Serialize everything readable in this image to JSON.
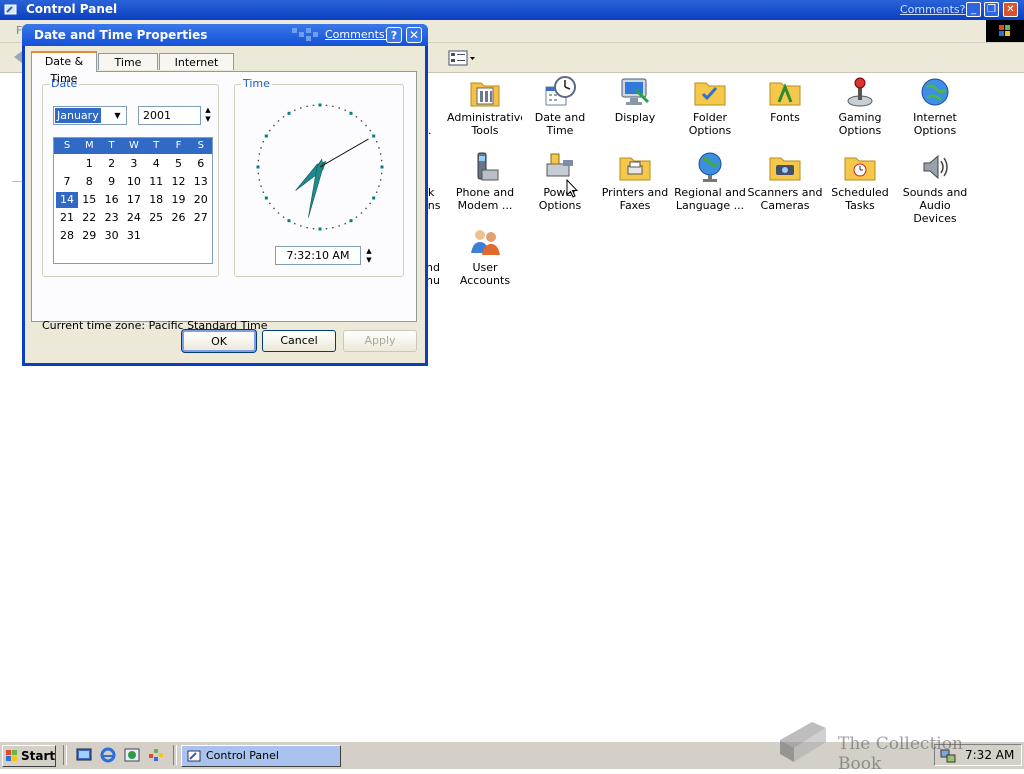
{
  "control_panel": {
    "title": "Control Panel",
    "comments_link": "Comments?",
    "menu_partial": "F",
    "items": [
      {
        "label": "Administrative Tools",
        "icon": "administrative-tools-icon"
      },
      {
        "label": "Date and Time",
        "icon": "date-and-time-icon"
      },
      {
        "label": "Display",
        "icon": "display-icon"
      },
      {
        "label": "Folder Options",
        "icon": "folder-options-icon"
      },
      {
        "label": "Fonts",
        "icon": "fonts-icon"
      },
      {
        "label": "Gaming Options",
        "icon": "gaming-options-icon"
      },
      {
        "label": "Internet Options",
        "icon": "internet-options-icon"
      },
      {
        "label": "Phone and Modem ...",
        "icon": "phone-and-modem-icon"
      },
      {
        "label": "Power Options",
        "icon": "power-options-icon"
      },
      {
        "label": "Printers and Faxes",
        "icon": "printers-and-faxes-icon"
      },
      {
        "label": "Regional and Language ...",
        "icon": "regional-language-icon"
      },
      {
        "label": "Scanners and Cameras",
        "icon": "scanners-cameras-icon"
      },
      {
        "label": "Scheduled Tasks",
        "icon": "scheduled-tasks-icon"
      },
      {
        "label": "Sounds and Audio Devices",
        "icon": "sounds-audio-icon"
      },
      {
        "label": "User Accounts",
        "icon": "user-accounts-icon"
      }
    ],
    "partially_hidden_labels": [
      ".",
      "k",
      "ons",
      "nd",
      "nu"
    ]
  },
  "dialog": {
    "title": "Date and Time Properties",
    "comments_link": "Comments?",
    "help_label": "?",
    "close_label": "✕",
    "tabs": [
      "Date & Time",
      "Time Zone",
      "Internet Time"
    ],
    "active_tab": "Date & Time",
    "date_group_label": "Date",
    "time_group_label": "Time",
    "month": "January",
    "year": "2001",
    "weekday_headers": [
      "S",
      "M",
      "T",
      "W",
      "T",
      "F",
      "S"
    ],
    "days": [
      "1",
      "2",
      "3",
      "4",
      "5",
      "6",
      "7",
      "8",
      "9",
      "10",
      "11",
      "12",
      "13",
      "14",
      "15",
      "16",
      "17",
      "18",
      "19",
      "20",
      "21",
      "22",
      "23",
      "24",
      "25",
      "26",
      "27",
      "28",
      "29",
      "30",
      "31"
    ],
    "first_weekday_index": 1,
    "selected_day": "14",
    "time": "7:32:10 AM",
    "clock": {
      "hour": 7,
      "minute": 32,
      "second": 10
    },
    "timezone_text": "Current time zone:  Pacific Standard Time",
    "buttons": {
      "ok": "OK",
      "cancel": "Cancel",
      "apply": "Apply"
    }
  },
  "taskbar": {
    "start_label": "Start",
    "task_label": "Control Panel",
    "clock": "7:32 AM",
    "quick_launch": [
      "show-desktop-icon",
      "internet-explorer-icon",
      "windows-update-icon",
      "messenger-icon"
    ]
  },
  "watermark": {
    "text": "The Collection Book"
  },
  "colors": {
    "title_blue": "#0a3fbf",
    "selection": "#316ac5",
    "dialog_face": "#ece9d8",
    "tab_highlight": "#e68b2c"
  }
}
